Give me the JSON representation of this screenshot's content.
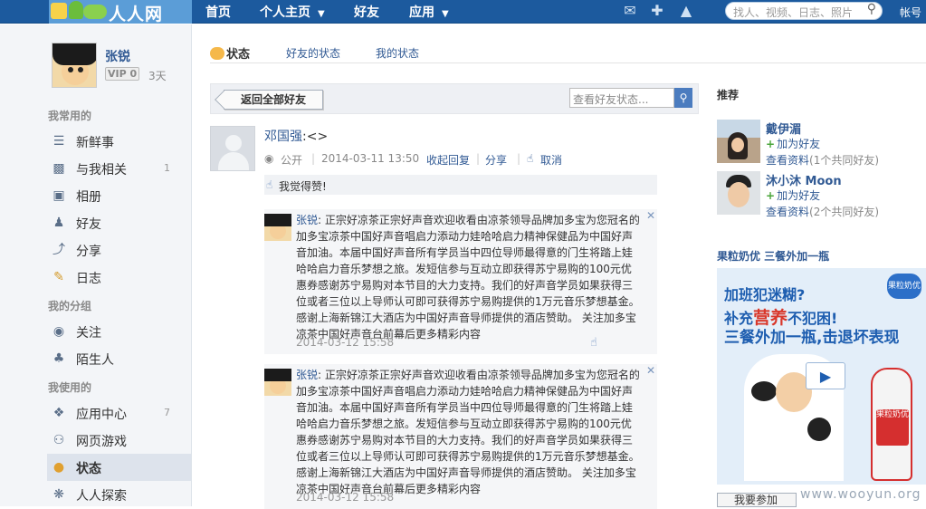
{
  "topbar": {
    "logo_text": "人人网",
    "nav": [
      "首页",
      "个人主页",
      "好友",
      "应用"
    ],
    "search_placeholder": "找人、视频、日志、照片",
    "account": "帐号",
    "icons": [
      "chat-icon",
      "add-friend-icon",
      "bell-icon"
    ]
  },
  "profile": {
    "name": "张锐",
    "vip": "VIP 0",
    "days": "3天"
  },
  "sidebar": {
    "sections": [
      {
        "title": "我常用的",
        "items": [
          {
            "label": "新鲜事",
            "icon": "news-icon",
            "count": ""
          },
          {
            "label": "与我相关",
            "icon": "related-icon",
            "count": "1"
          },
          {
            "label": "相册",
            "icon": "album-icon",
            "count": ""
          },
          {
            "label": "好友",
            "icon": "friends-icon",
            "count": ""
          },
          {
            "label": "分享",
            "icon": "share-icon",
            "count": ""
          },
          {
            "label": "日志",
            "icon": "blog-icon",
            "count": ""
          }
        ]
      },
      {
        "title": "我的分组",
        "items": [
          {
            "label": "关注",
            "icon": "rss-icon",
            "count": ""
          },
          {
            "label": "陌生人",
            "icon": "stranger-icon",
            "count": ""
          }
        ]
      },
      {
        "title": "我使用的",
        "items": [
          {
            "label": "应用中心",
            "icon": "puzzle-icon",
            "count": "7"
          },
          {
            "label": "网页游戏",
            "icon": "gamepad-icon",
            "count": ""
          },
          {
            "label": "状态",
            "icon": "status-icon",
            "count": ""
          },
          {
            "label": "人人探索",
            "icon": "compass-icon",
            "count": ""
          }
        ]
      }
    ]
  },
  "tabs": [
    "状态",
    "好友的状态",
    "我的状态"
  ],
  "filter": {
    "back_label": "返回全部好友",
    "search_placeholder": "查看好友状态..."
  },
  "post": {
    "author": "邓国强",
    "text": ":<>",
    "visibility": "公开",
    "time": "2014-03-11 13:50",
    "actions": [
      "收起回复",
      "分享",
      "取消"
    ],
    "like_text": "我觉得赞!"
  },
  "comments": [
    {
      "author": "张锐",
      "text": ": 正宗好凉茶正宗好声音欢迎收看由凉茶领导品牌加多宝为您冠名的加多宝凉茶中国好声音唱启力添动力娃哈哈启力精神保健品为中国好声音加油。本届中国好声音所有学员当中四位导师最得意的门生将踏上娃哈哈启力音乐梦想之旅。发短信参与互动立即获得苏宁易购的100元优惠券感谢苏宁易购对本节目的大力支持。我们的好声音学员如果获得三位或者三位以上导师认可即可获得苏宁易购提供的1万元音乐梦想基金。感谢上海新锦江大酒店为中国好声音导师提供的酒店赞助。 关注加多宝凉茶中国好声音台前幕后更多精彩内容",
      "time": "2014-03-12 15:58"
    },
    {
      "author": "张锐",
      "text": ": 正宗好凉茶正宗好声音欢迎收看由凉茶领导品牌加多宝为您冠名的加多宝凉茶中国好声音唱启力添动力娃哈哈启力精神保健品为中国好声音加油。本届中国好声音所有学员当中四位导师最得意的门生将踏上娃哈哈启力音乐梦想之旅。发短信参与互动立即获得苏宁易购的100元优惠券感谢苏宁易购对本节目的大力支持。我们的好声音学员如果获得三位或者三位以上导师认可即可获得苏宁易购提供的1万元音乐梦想基金。感谢上海新锦江大酒店为中国好声音导师提供的酒店赞助。 关注加多宝凉茶中国好声音台前幕后更多精彩内容",
      "time": "2014-03-12 15:58"
    }
  ],
  "right": {
    "recommend_title": "推荐",
    "people": [
      {
        "name": "戴伊湄",
        "add": "加为好友",
        "info": "查看资料",
        "mutual": "(1个共同好友)"
      },
      {
        "name": "沐小沐 Moon",
        "add": "加为好友",
        "info": "查看资料",
        "mutual": "(2个共同好友)"
      }
    ],
    "ad_title": "果粒奶优 三餐外加一瓶",
    "ad_line1": "加班犯迷糊?",
    "ad_line2a": "补充",
    "ad_line2b": "营养",
    "ad_line2c": "不犯困!",
    "ad_line3": "三餐外加一瓶,击退坏表现",
    "ad_brand": "果粒奶优",
    "ad_bottle_label": "果粒奶优",
    "ad_button": "我要参加"
  },
  "watermark": "www.wooyun.org"
}
